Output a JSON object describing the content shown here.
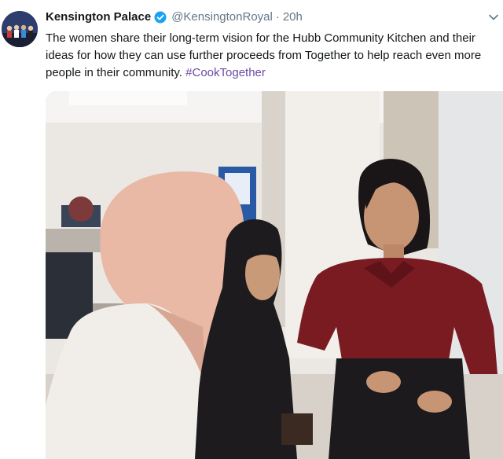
{
  "tweet": {
    "author_name": "Kensington Palace",
    "handle": "@KensingtonRoyal",
    "separator": "·",
    "time": "20h",
    "text": "The women share their long-term vision for the Hubb Community Kitchen and their ideas for how they can use further proceeds from Together to help reach even more people in their community.",
    "hashtag": "#CookTogether"
  },
  "icons": {
    "verified": "verified-badge-icon",
    "menu": "chevron-down-icon"
  },
  "colors": {
    "name": "#14171a",
    "meta": "#657786",
    "verified": "#1da1f2",
    "hashtag": "#6b4aa8"
  }
}
